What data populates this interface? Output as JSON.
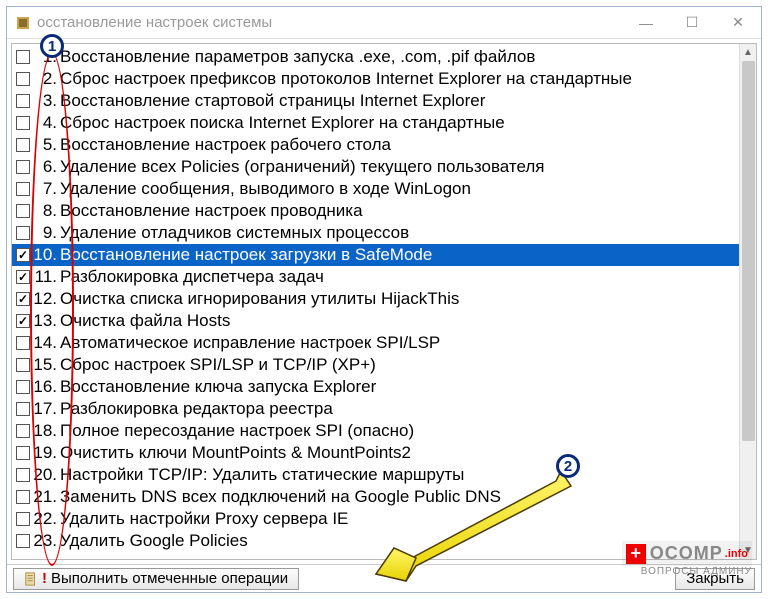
{
  "window": {
    "title": "осстановление настроек системы"
  },
  "items": [
    {
      "n": "1.",
      "checked": false,
      "selected": false,
      "label": "Восстановление параметров запуска .exe, .com, .pif файлов"
    },
    {
      "n": "2.",
      "checked": false,
      "selected": false,
      "label": "Сброс настроек префиксов протоколов Internet Explorer на стандартные"
    },
    {
      "n": "3.",
      "checked": false,
      "selected": false,
      "label": "Восстановление стартовой страницы Internet Explorer"
    },
    {
      "n": "4.",
      "checked": false,
      "selected": false,
      "label": "Сброс настроек поиска Internet Explorer на стандартные"
    },
    {
      "n": "5.",
      "checked": false,
      "selected": false,
      "label": "Восстановление настроек рабочего стола"
    },
    {
      "n": "6.",
      "checked": false,
      "selected": false,
      "label": "Удаление всех Policies (ограничений) текущего пользователя"
    },
    {
      "n": "7.",
      "checked": false,
      "selected": false,
      "label": "Удаление сообщения, выводимого в ходе WinLogon"
    },
    {
      "n": "8.",
      "checked": false,
      "selected": false,
      "label": "Восстановление настроек проводника"
    },
    {
      "n": "9.",
      "checked": false,
      "selected": false,
      "label": "Удаление отладчиков системных процессов"
    },
    {
      "n": "10.",
      "checked": true,
      "selected": true,
      "label": "Восстановление настроек загрузки в SafeMode"
    },
    {
      "n": "11.",
      "checked": true,
      "selected": false,
      "label": "Разблокировка диспетчера задач"
    },
    {
      "n": "12.",
      "checked": true,
      "selected": false,
      "label": "Очистка списка игнорирования утилиты HijackThis"
    },
    {
      "n": "13.",
      "checked": true,
      "selected": false,
      "label": "Очистка файла Hosts"
    },
    {
      "n": "14.",
      "checked": false,
      "selected": false,
      "label": "Автоматическое исправление настроек SPI/LSP"
    },
    {
      "n": "15.",
      "checked": false,
      "selected": false,
      "label": "Сброс настроек SPI/LSP и TCP/IP (XP+)"
    },
    {
      "n": "16.",
      "checked": false,
      "selected": false,
      "label": "Восстановление ключа запуска Explorer"
    },
    {
      "n": "17.",
      "checked": false,
      "selected": false,
      "label": "Разблокировка редактора реестра"
    },
    {
      "n": "18.",
      "checked": false,
      "selected": false,
      "label": "Полное пересоздание настроек SPI (опасно)"
    },
    {
      "n": "19.",
      "checked": false,
      "selected": false,
      "label": "Очистить ключи MountPoints & MountPoints2"
    },
    {
      "n": "20.",
      "checked": false,
      "selected": false,
      "label": "Настройки TCP/IP: Удалить статические маршруты"
    },
    {
      "n": "21.",
      "checked": false,
      "selected": false,
      "label": "Заменить DNS всех подключений на Google Public DNS"
    },
    {
      "n": "22.",
      "checked": false,
      "selected": false,
      "label": "Удалить настройки Proxy сервера IE"
    },
    {
      "n": "23.",
      "checked": false,
      "selected": false,
      "label": "Удалить Google Policies"
    }
  ],
  "buttons": {
    "execute": "Выполнить отмеченные операции",
    "close": "Закрыть"
  },
  "badges": {
    "one": "1",
    "two": "2"
  },
  "watermark": {
    "brand": "OCOMP",
    "tld": ".info",
    "sub": "ВОПРОСЫ АДМИНУ"
  }
}
